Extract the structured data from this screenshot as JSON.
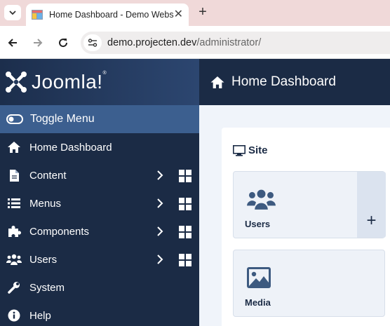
{
  "browser": {
    "tab_title": "Home Dashboard - Demo Website",
    "tab_close": "✕",
    "new_tab": "+",
    "url_host": "demo.projecten.dev",
    "url_path": "/administrator/"
  },
  "brand": {
    "logo_text": "Joomla!",
    "trademark": "®"
  },
  "sidebar": {
    "toggle_label": "Toggle Menu",
    "items": [
      {
        "label": "Home Dashboard",
        "icon": "home-icon"
      },
      {
        "label": "Content",
        "icon": "file-icon",
        "has_submenu": true
      },
      {
        "label": "Menus",
        "icon": "list-icon",
        "has_submenu": true
      },
      {
        "label": "Components",
        "icon": "puzzle-icon",
        "has_submenu": true
      },
      {
        "label": "Users",
        "icon": "users-icon",
        "has_submenu": true
      },
      {
        "label": "System",
        "icon": "wrench-icon"
      },
      {
        "label": "Help",
        "icon": "info-icon"
      }
    ]
  },
  "header": {
    "title": "Home Dashboard"
  },
  "main": {
    "panel_title": "Site",
    "cards": [
      {
        "label": "Users",
        "icon": "users-icon",
        "add": "+"
      },
      {
        "label": "Media",
        "icon": "image-icon"
      }
    ]
  },
  "colors": {
    "sidebar_bg": "#1b2b45",
    "toggle_bg": "#3c5f8f",
    "card_icon": "#3d5a80",
    "tabbar_bg": "#f0d9d9"
  }
}
